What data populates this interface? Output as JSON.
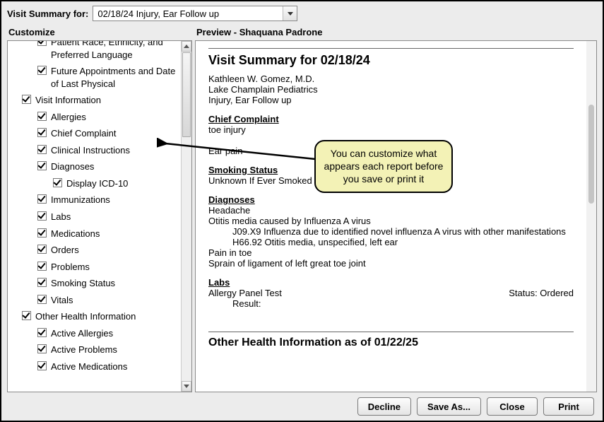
{
  "header": {
    "label": "Visit Summary for:",
    "dropdown_value": "02/18/24 Injury, Ear Follow up"
  },
  "customize": {
    "heading": "Customize",
    "items": [
      {
        "level": 1,
        "checked": true,
        "label": "Patient Race, Ethnicity, and Preferred Language"
      },
      {
        "level": 1,
        "checked": true,
        "label": "Future Appointments and Date of Last Physical"
      },
      {
        "level": 0,
        "checked": true,
        "label": "Visit Information"
      },
      {
        "level": 1,
        "checked": true,
        "label": "Allergies"
      },
      {
        "level": 1,
        "checked": true,
        "label": "Chief Complaint"
      },
      {
        "level": 1,
        "checked": true,
        "label": "Clinical Instructions"
      },
      {
        "level": 1,
        "checked": true,
        "label": "Diagnoses"
      },
      {
        "level": 2,
        "checked": true,
        "label": "Display ICD-10"
      },
      {
        "level": 1,
        "checked": true,
        "label": "Immunizations"
      },
      {
        "level": 1,
        "checked": true,
        "label": "Labs"
      },
      {
        "level": 1,
        "checked": true,
        "label": "Medications"
      },
      {
        "level": 1,
        "checked": true,
        "label": "Orders"
      },
      {
        "level": 1,
        "checked": true,
        "label": "Problems"
      },
      {
        "level": 1,
        "checked": true,
        "label": "Smoking Status"
      },
      {
        "level": 1,
        "checked": true,
        "label": "Vitals"
      },
      {
        "level": 0,
        "checked": true,
        "label": "Other Health Information"
      },
      {
        "level": 1,
        "checked": true,
        "label": "Active Allergies"
      },
      {
        "level": 1,
        "checked": true,
        "label": "Active Problems"
      },
      {
        "level": 1,
        "checked": true,
        "label": "Active Medications"
      }
    ]
  },
  "preview": {
    "heading": "Preview - Shaquana Padrone",
    "title": "Visit Summary for 02/18/24",
    "provider": "Kathleen W. Gomez, M.D.",
    "practice": "Lake Champlain Pediatrics",
    "visit_type": "Injury, Ear Follow up",
    "sections": {
      "chief_complaint": {
        "head": "Chief Complaint",
        "lines": [
          "toe injury",
          "",
          "Ear pain"
        ]
      },
      "smoking": {
        "head": "Smoking Status",
        "lines": [
          "Unknown If Ever Smoked"
        ]
      },
      "diagnoses": {
        "head": "Diagnoses",
        "lines": [
          "Headache",
          "Otitis media caused by Influenza A virus",
          "    J09.X9 Influenza due to identified novel influenza A virus with other manifestations",
          "    H66.92 Otitis media, unspecified, left ear",
          "Pain in toe",
          "Sprain of ligament of left great toe joint"
        ]
      },
      "labs": {
        "head": "Labs",
        "test": "Allergy Panel Test",
        "status": "Status: Ordered",
        "result_label": "Result:"
      }
    },
    "other_heading": "Other Health Information as of 01/22/25"
  },
  "callout": {
    "text": "You can customize what appears each report before you save or print it"
  },
  "buttons": {
    "decline": "Decline",
    "save_as": "Save As...",
    "close": "Close",
    "print": "Print"
  }
}
